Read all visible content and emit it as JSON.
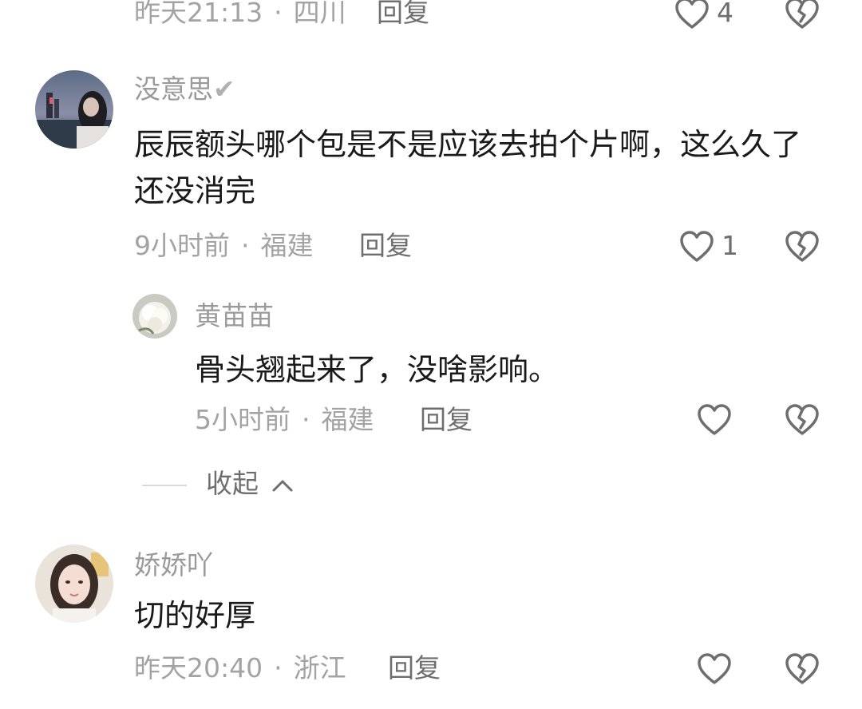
{
  "comments": [
    {
      "time": "昨天21:13",
      "location": "四川",
      "reply_label": "回复",
      "likes": "4"
    },
    {
      "username": "没意思",
      "verified_mark": "✔",
      "text": "辰辰额头哪个包是不是应该去拍个片啊，这么久了还没消完",
      "time": "9小时前",
      "location": "福建",
      "reply_label": "回复",
      "likes": "1",
      "replies": [
        {
          "username": "黄苗苗",
          "text": "骨头翘起来了，没啥影响。",
          "time": "5小时前",
          "location": "福建",
          "reply_label": "回复",
          "likes": ""
        }
      ],
      "collapse_label": "收起",
      "collapse_icon": "chevron-up-icon"
    },
    {
      "username": "娇娇吖",
      "text": "切的好厚",
      "time": "昨天20:40",
      "location": "浙江",
      "reply_label": "回复",
      "likes": ""
    }
  ],
  "separator": "·",
  "colors": {
    "meta_text": "#a3a3a3",
    "body_text": "#1a1a1a",
    "icon_stroke": "#6e6e6e",
    "background": "#ffffff"
  }
}
